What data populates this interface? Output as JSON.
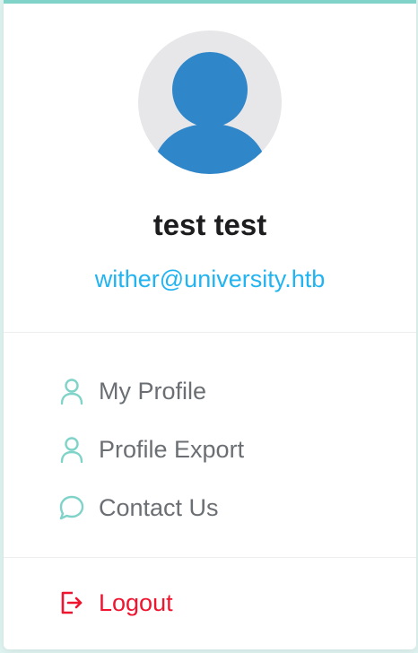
{
  "user": {
    "name": "test test",
    "email": "wither@university.htb"
  },
  "menu": {
    "items": [
      {
        "label": "My Profile",
        "icon": "user-icon"
      },
      {
        "label": "Profile Export",
        "icon": "user-icon"
      },
      {
        "label": "Contact Us",
        "icon": "chat-bubble-icon"
      }
    ]
  },
  "logout": {
    "label": "Logout",
    "icon": "logout-icon"
  },
  "colors": {
    "accent": "#7fd3c8",
    "email": "#22b4f0",
    "logout": "#f0142f",
    "avatar_figure": "#2f86c9",
    "avatar_bg": "#e7e7e9"
  }
}
